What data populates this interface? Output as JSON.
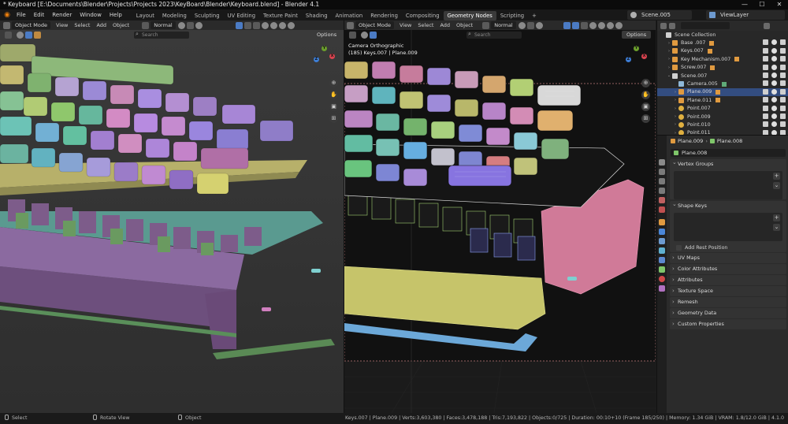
{
  "window": {
    "title": "* Keyboard [E:\\Documents\\Blender\\Projects\\Projects 2023\\KeyBoard\\Blender\\Keyboard.blend] - Blender 4.1",
    "controls": [
      "—",
      "☐",
      "✕"
    ]
  },
  "menu": [
    "File",
    "Edit",
    "Render",
    "Window",
    "Help"
  ],
  "workspaces": [
    "Layout",
    "Modeling",
    "Sculpting",
    "UV Editing",
    "Texture Paint",
    "Shading",
    "Animation",
    "Rendering",
    "Compositing",
    "Geometry Nodes",
    "Scripting",
    "+"
  ],
  "active_workspace": "Geometry Nodes",
  "scene": "Scene.005",
  "view_layer": "ViewLayer",
  "viewport_left": {
    "mode": "Object Mode",
    "menus": [
      "View",
      "Select",
      "Add",
      "Object"
    ],
    "orientation": "Normal",
    "search_placeholder": "Search",
    "options": "Options"
  },
  "viewport_right": {
    "mode": "Object Mode",
    "menus": [
      "View",
      "Select",
      "Add",
      "Object"
    ],
    "orientation": "Normal",
    "search_placeholder": "Search",
    "options": "Options",
    "camera_label": "Camera Orthographic",
    "camera_sublabel": "(185) Keys.007 | Plane.009"
  },
  "gizmo_labels": {
    "x": "X",
    "y": "Y",
    "z": "Z"
  },
  "outliner": {
    "search_placeholder": "",
    "rows": [
      {
        "label": "Scene Collection",
        "indent": 0,
        "icon": "collection",
        "color": "#d0d0d0",
        "vis": false,
        "selected": false,
        "expand": ""
      },
      {
        "label": "Base .007",
        "indent": 1,
        "icon": "mesh",
        "color": "#e09a40",
        "vis": true,
        "selected": false,
        "expand": "›"
      },
      {
        "label": "Keys.007",
        "indent": 1,
        "icon": "mesh",
        "color": "#e09a40",
        "vis": true,
        "selected": false,
        "expand": "›"
      },
      {
        "label": "Key Mechanism.007",
        "indent": 1,
        "icon": "mesh",
        "color": "#e09a40",
        "vis": true,
        "selected": false,
        "expand": "›"
      },
      {
        "label": "Screw.007",
        "indent": 1,
        "icon": "mesh",
        "color": "#e09a40",
        "vis": true,
        "selected": false,
        "expand": "›"
      },
      {
        "label": "Scene.007",
        "indent": 1,
        "icon": "collection",
        "color": "#d0d0d0",
        "vis": true,
        "selected": false,
        "expand": "⌄"
      },
      {
        "label": "Camera.005",
        "indent": 2,
        "icon": "camera",
        "color": "#8fb8d8",
        "vis": true,
        "selected": false,
        "expand": ""
      },
      {
        "label": "Plane.009",
        "indent": 2,
        "icon": "mesh",
        "color": "#e09a40",
        "vis": true,
        "selected": true,
        "expand": "›"
      },
      {
        "label": "Plane.011",
        "indent": 2,
        "icon": "mesh",
        "color": "#e09a40",
        "vis": true,
        "selected": false,
        "expand": "›"
      },
      {
        "label": "Point.007",
        "indent": 2,
        "icon": "light",
        "color": "#e0b040",
        "vis": true,
        "selected": false,
        "expand": "›"
      },
      {
        "label": "Point.009",
        "indent": 2,
        "icon": "light",
        "color": "#e0b040",
        "vis": true,
        "selected": false,
        "expand": "›"
      },
      {
        "label": "Point.010",
        "indent": 2,
        "icon": "light",
        "color": "#e0b040",
        "vis": true,
        "selected": false,
        "expand": "›"
      },
      {
        "label": "Point.011",
        "indent": 2,
        "icon": "light",
        "color": "#e0b040",
        "vis": true,
        "selected": false,
        "expand": "›"
      }
    ]
  },
  "properties": {
    "breadcrumb_object": "Plane.009",
    "breadcrumb_data": "Plane.008",
    "data_name": "Plane.008",
    "vertex_groups": "Vertex Groups",
    "shape_keys": "Shape Keys",
    "add_rest_position": "Add Rest Position",
    "collapsed_panels": [
      "UV Maps",
      "Color Attributes",
      "Attributes",
      "Texture Space",
      "Remesh",
      "Geometry Data",
      "Custom Properties"
    ]
  },
  "statusbar": {
    "select": "Select",
    "rotate": "Rotate View",
    "object": "Object",
    "stats": "Keys.007 | Plane.009 | Verts:3,603,380 | Faces:3,478,188 | Tris:7,193,822 | Objects:0/725 | Duration: 00:10+10 (Frame 185/250) | Memory: 1.34 GiB | VRAM: 1.8/12.0 GiB | 4.1.0"
  },
  "colors": {
    "accent": "#4b7bc4",
    "selection": "#334d80",
    "blender_orange": "#e87d0d"
  }
}
